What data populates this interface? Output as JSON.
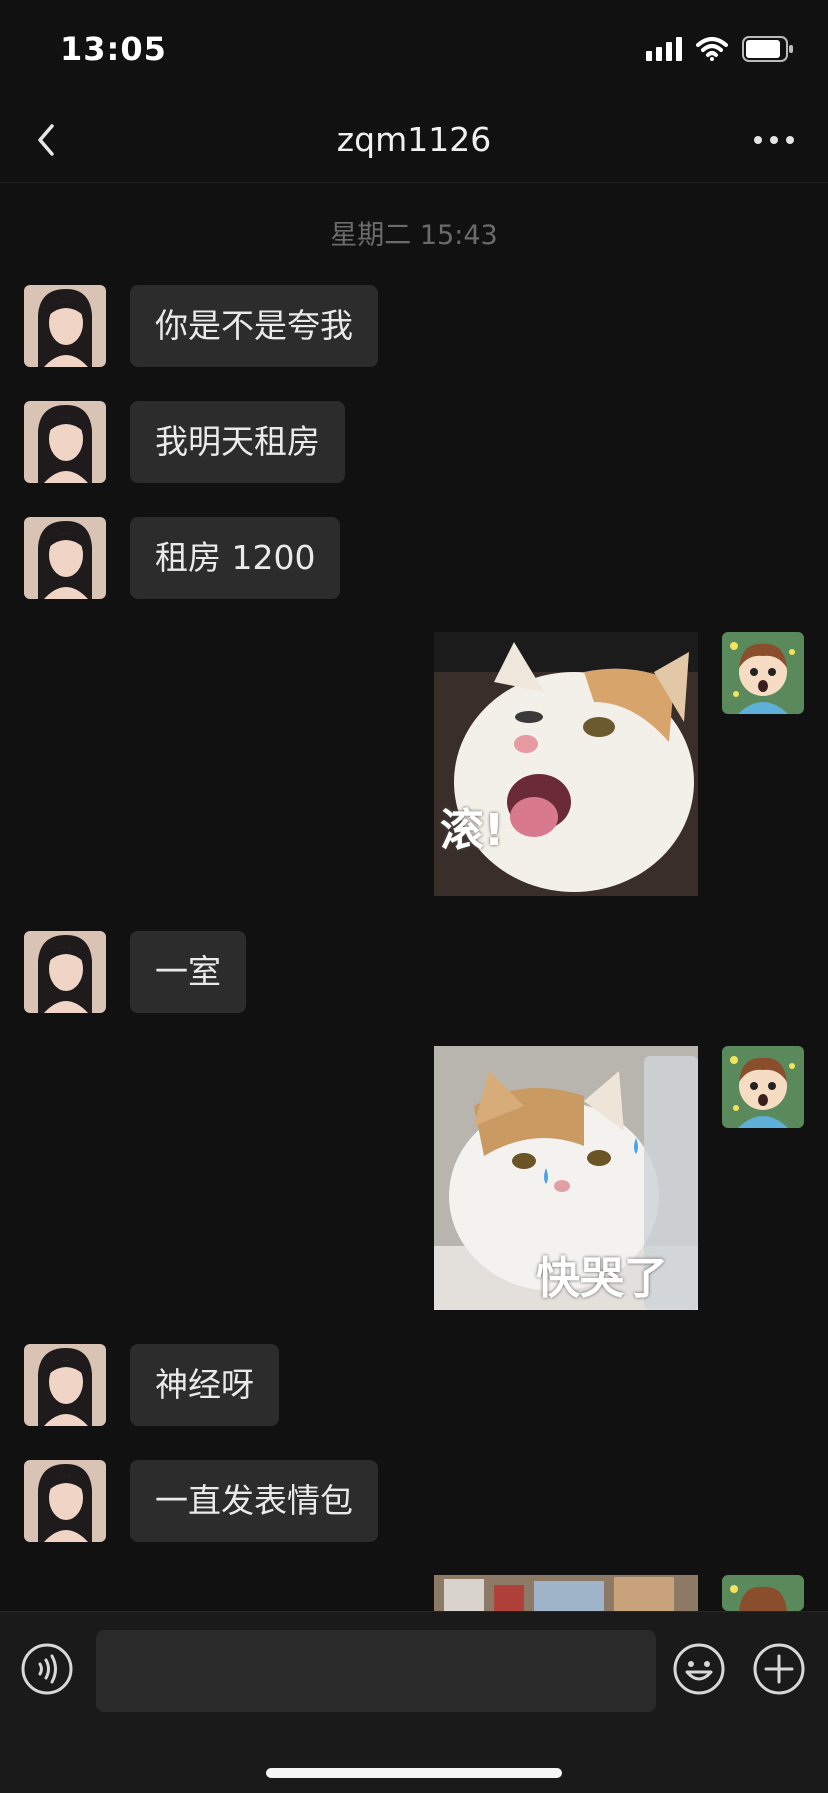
{
  "status": {
    "time": "13:05"
  },
  "header": {
    "title": "zqm1126"
  },
  "chat": {
    "timestamp": "星期二 15:43",
    "msg1": "你是不是夸我",
    "msg2": "我明天租房",
    "msg3": "租房 1200",
    "sticker1_text": "滚!",
    "msg4": "一室",
    "sticker2_text": "快哭了",
    "msg5": "神经呀",
    "msg6": "一直发表情包"
  },
  "colors": {
    "background": "#111111",
    "bubble": "#2c2c2c",
    "accent": "#ffffff"
  }
}
